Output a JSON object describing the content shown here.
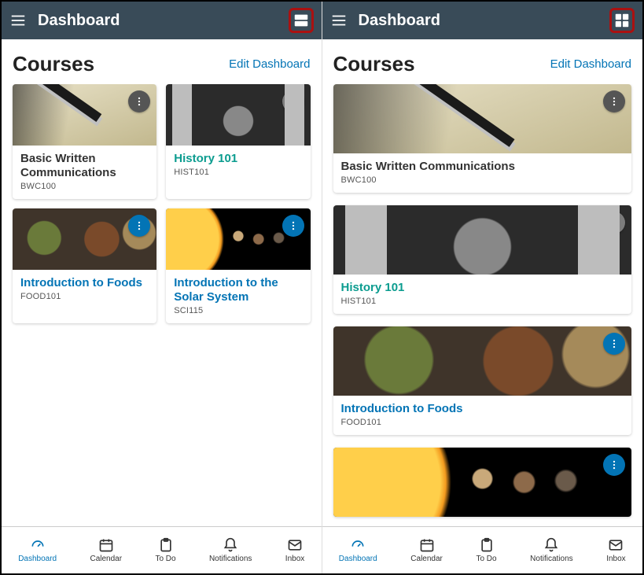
{
  "leftPane": {
    "header": {
      "title": "Dashboard",
      "layoutMode": "grid"
    },
    "section": {
      "title": "Courses",
      "editLabel": "Edit Dashboard"
    },
    "courses": [
      {
        "title": "Basic Written Communications",
        "code": "BWC100",
        "accent": "gray",
        "img": "pen",
        "moreBg": "#555"
      },
      {
        "title": "History 101",
        "code": "HIST101",
        "accent": "teal",
        "img": "lincoln",
        "moreBg": "#0B9C8F"
      },
      {
        "title": "Introduction to Foods",
        "code": "FOOD101",
        "accent": "blue",
        "img": "foods",
        "moreBg": "#0374B5"
      },
      {
        "title": "Introduction to the Solar System",
        "code": "SCI115",
        "accent": "blue",
        "img": "solar",
        "moreBg": "#0374B5"
      }
    ]
  },
  "rightPane": {
    "header": {
      "title": "Dashboard",
      "layoutMode": "list"
    },
    "section": {
      "title": "Courses",
      "editLabel": "Edit Dashboard"
    },
    "courses": [
      {
        "title": "Basic Written Communications",
        "code": "BWC100",
        "accent": "gray",
        "img": "pen",
        "moreBg": "#555"
      },
      {
        "title": "History 101",
        "code": "HIST101",
        "accent": "green",
        "img": "lincoln",
        "moreBg": "#0B9C8F"
      },
      {
        "title": "Introduction to Foods",
        "code": "FOOD101",
        "accent": "blue",
        "img": "foods",
        "moreBg": "#0374B5"
      },
      {
        "title": "",
        "code": "",
        "accent": "blue",
        "img": "solar",
        "moreBg": "#0374B5"
      }
    ]
  },
  "nav": {
    "items": [
      {
        "key": "dashboard",
        "label": "Dashboard",
        "active": true
      },
      {
        "key": "calendar",
        "label": "Calendar",
        "active": false
      },
      {
        "key": "todo",
        "label": "To Do",
        "active": false
      },
      {
        "key": "notifications",
        "label": "Notifications",
        "active": false
      },
      {
        "key": "inbox",
        "label": "Inbox",
        "active": false
      }
    ]
  },
  "icons": {
    "more": "more-vertical-icon",
    "hamburger": "hamburger-icon",
    "layoutGrid": "layout-grid-icon",
    "layoutStack": "layout-stack-icon"
  }
}
